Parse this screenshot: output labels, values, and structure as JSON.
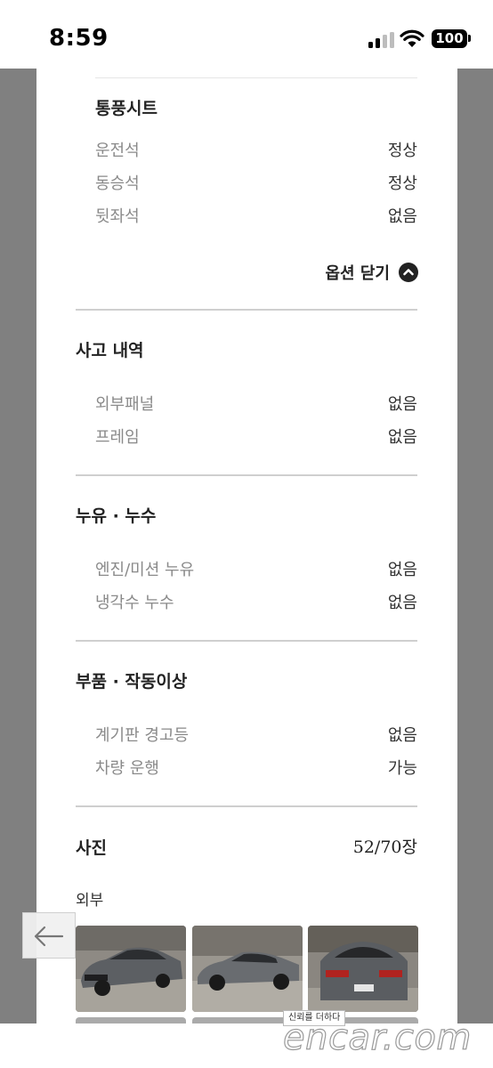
{
  "status_bar": {
    "time": "8:59",
    "battery": "100"
  },
  "ventilation": {
    "title": "통풍시트",
    "rows": [
      {
        "label": "운전석",
        "value": "정상"
      },
      {
        "label": "동승석",
        "value": "정상"
      },
      {
        "label": "뒷좌석",
        "value": "없음"
      }
    ],
    "option_close": "옵션 닫기"
  },
  "accident": {
    "title": "사고 내역",
    "rows": [
      {
        "label": "외부패널",
        "value": "없음"
      },
      {
        "label": "프레임",
        "value": "없음"
      }
    ]
  },
  "leak": {
    "title": "누유 · 누수",
    "rows": [
      {
        "label": "엔진/미션 누유",
        "value": "없음"
      },
      {
        "label": "냉각수 누수",
        "value": "없음"
      }
    ]
  },
  "parts": {
    "title": "부품 · 작동이상",
    "rows": [
      {
        "label": "계기판 경고등",
        "value": "없음"
      },
      {
        "label": "차량 운행",
        "value": "가능"
      }
    ]
  },
  "photos": {
    "title": "사진",
    "count": "52/70장",
    "exterior_label": "외부"
  },
  "tooltip": "신뢰를 더하다",
  "watermark": "encar.com",
  "colors": {
    "side_gray": "#808080",
    "divider": "#cfcfcf",
    "label_gray": "#8a8a8a",
    "text_dark": "#222222"
  }
}
